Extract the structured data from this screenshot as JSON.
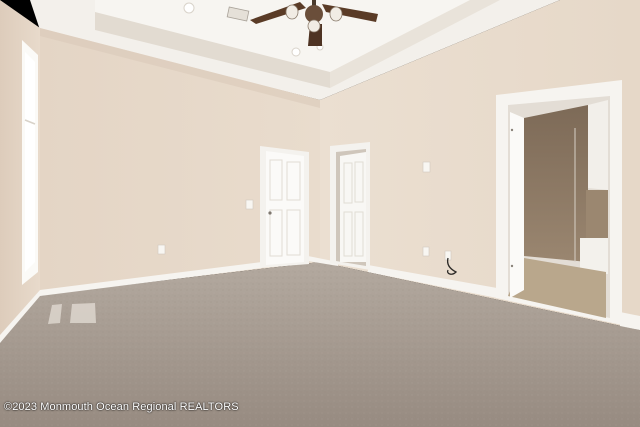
{
  "photo": {
    "watermark": "©2023 Monmouth Ocean Regional REALTORS"
  },
  "colors": {
    "wall_left": "#e6d7c8",
    "wall_right": "#e9dccd",
    "ceiling": "#f4f1ec",
    "trim": "#f6f4f0",
    "carpet": "#a49990",
    "bath_tile": "#8a7560",
    "bath_floor": "#b8a58a"
  }
}
